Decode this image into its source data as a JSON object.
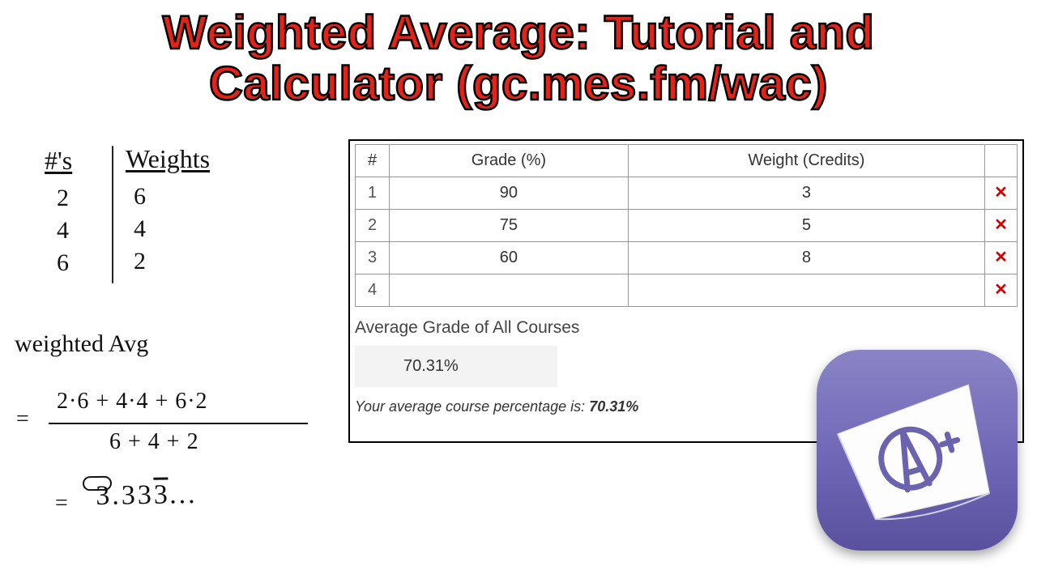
{
  "title_line1": "Weighted Average: Tutorial and",
  "title_line2": "Calculator (gc.mes.fm/wac)",
  "handwriting": {
    "col1_header": "#'s",
    "col2_header": "Weights",
    "rows": [
      {
        "n": "2",
        "w": "6"
      },
      {
        "n": "4",
        "w": "4"
      },
      {
        "n": "6",
        "w": "2"
      }
    ],
    "label": "weighted Avg",
    "numerator": "2·6 + 4·4 + 6·2",
    "denominator": "6 + 4 + 2",
    "result_prefix": "3.33",
    "result_overline": "3",
    "result_suffix": "…"
  },
  "chart_data": {
    "type": "table",
    "columns": [
      "#",
      "Grade (%)",
      "Weight (Credits)"
    ],
    "rows": [
      {
        "idx": 1,
        "grade": 90,
        "weight": 3
      },
      {
        "idx": 2,
        "grade": 75,
        "weight": 5
      },
      {
        "idx": 3,
        "grade": 60,
        "weight": 8
      },
      {
        "idx": 4,
        "grade": "",
        "weight": ""
      }
    ],
    "average_percent": 70.31
  },
  "calc_ui": {
    "header_idx": "#",
    "header_grade": "Grade (%)",
    "header_weight": "Weight (Credits)",
    "avg_label": "Average Grade of All Courses",
    "avg_value": "70.31%",
    "avg_sentence_prefix": "Your average course percentage is: ",
    "avg_sentence_value": "70.31%"
  },
  "icon": {
    "grade_text": "A+"
  }
}
